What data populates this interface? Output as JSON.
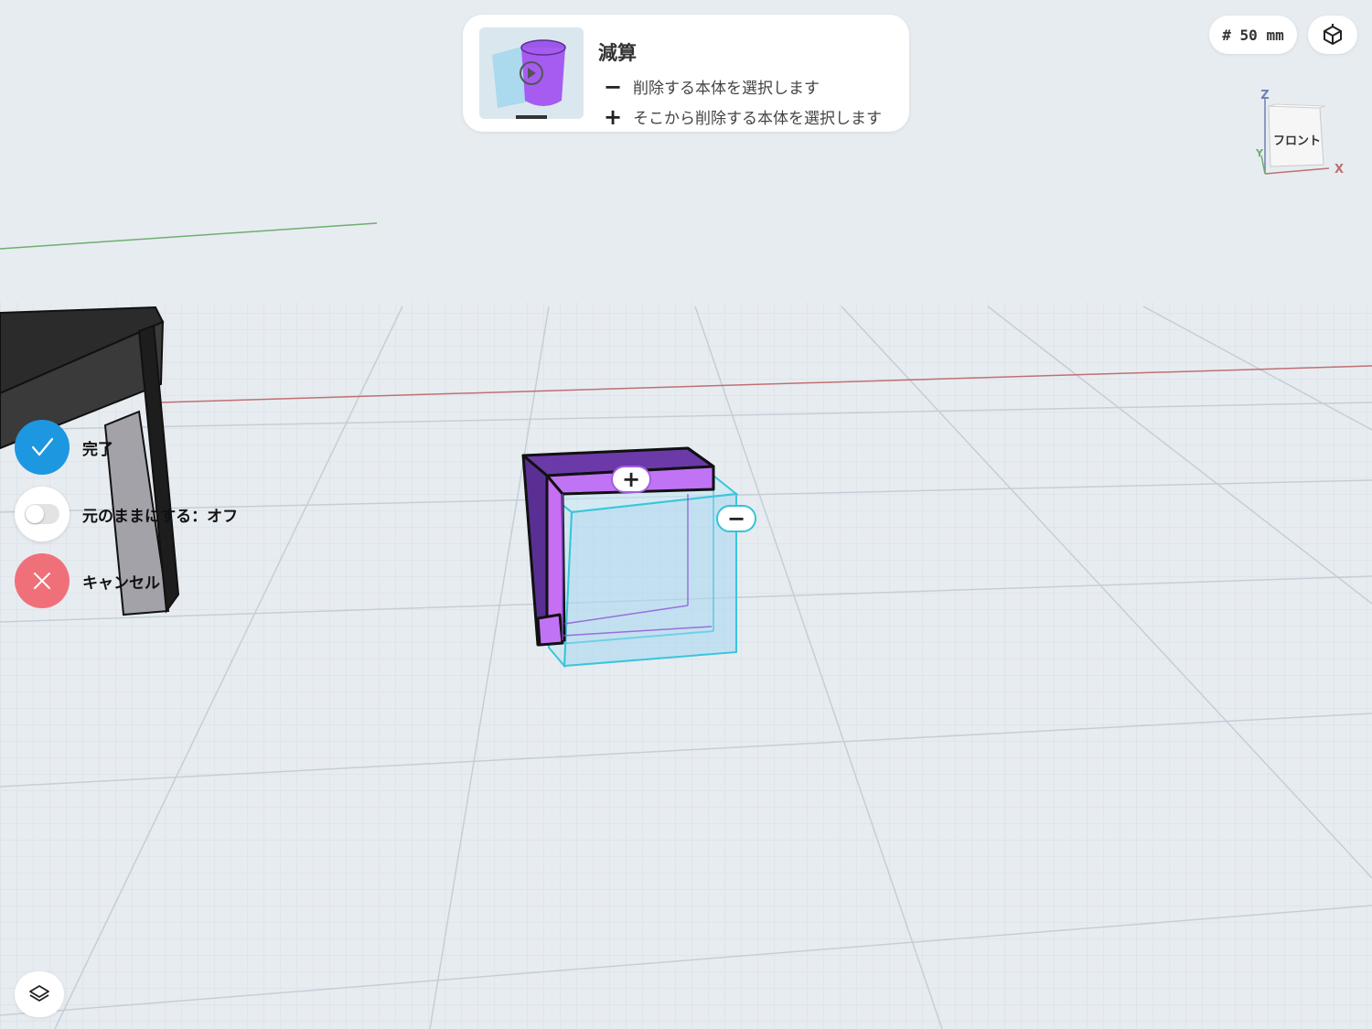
{
  "instruction": {
    "title": "減算",
    "steps": [
      {
        "symbol": "−",
        "text": "削除する本体を選択します"
      },
      {
        "symbol": "+",
        "text": "そこから削除する本体を選択します"
      }
    ]
  },
  "grid": {
    "label": "# 50 mm"
  },
  "view_cube": {
    "face_label": "フロント",
    "axis_z": "Z",
    "axis_y": "Y",
    "axis_x": "X"
  },
  "actions": {
    "done": "完了",
    "keep_original": "元のままにする：オフ",
    "cancel": "キャンセル"
  },
  "handles": {
    "add": "+",
    "remove": "−"
  },
  "colors": {
    "accent_blue": "#1d98e0",
    "cancel_red": "#f0707a",
    "target_purple": "#a25de3",
    "tool_cyan": "#35c2d8"
  },
  "icons": {
    "check": "checkmark-icon",
    "cancel": "close-icon",
    "view": "view-cube-icon",
    "layers": "layers-icon"
  }
}
